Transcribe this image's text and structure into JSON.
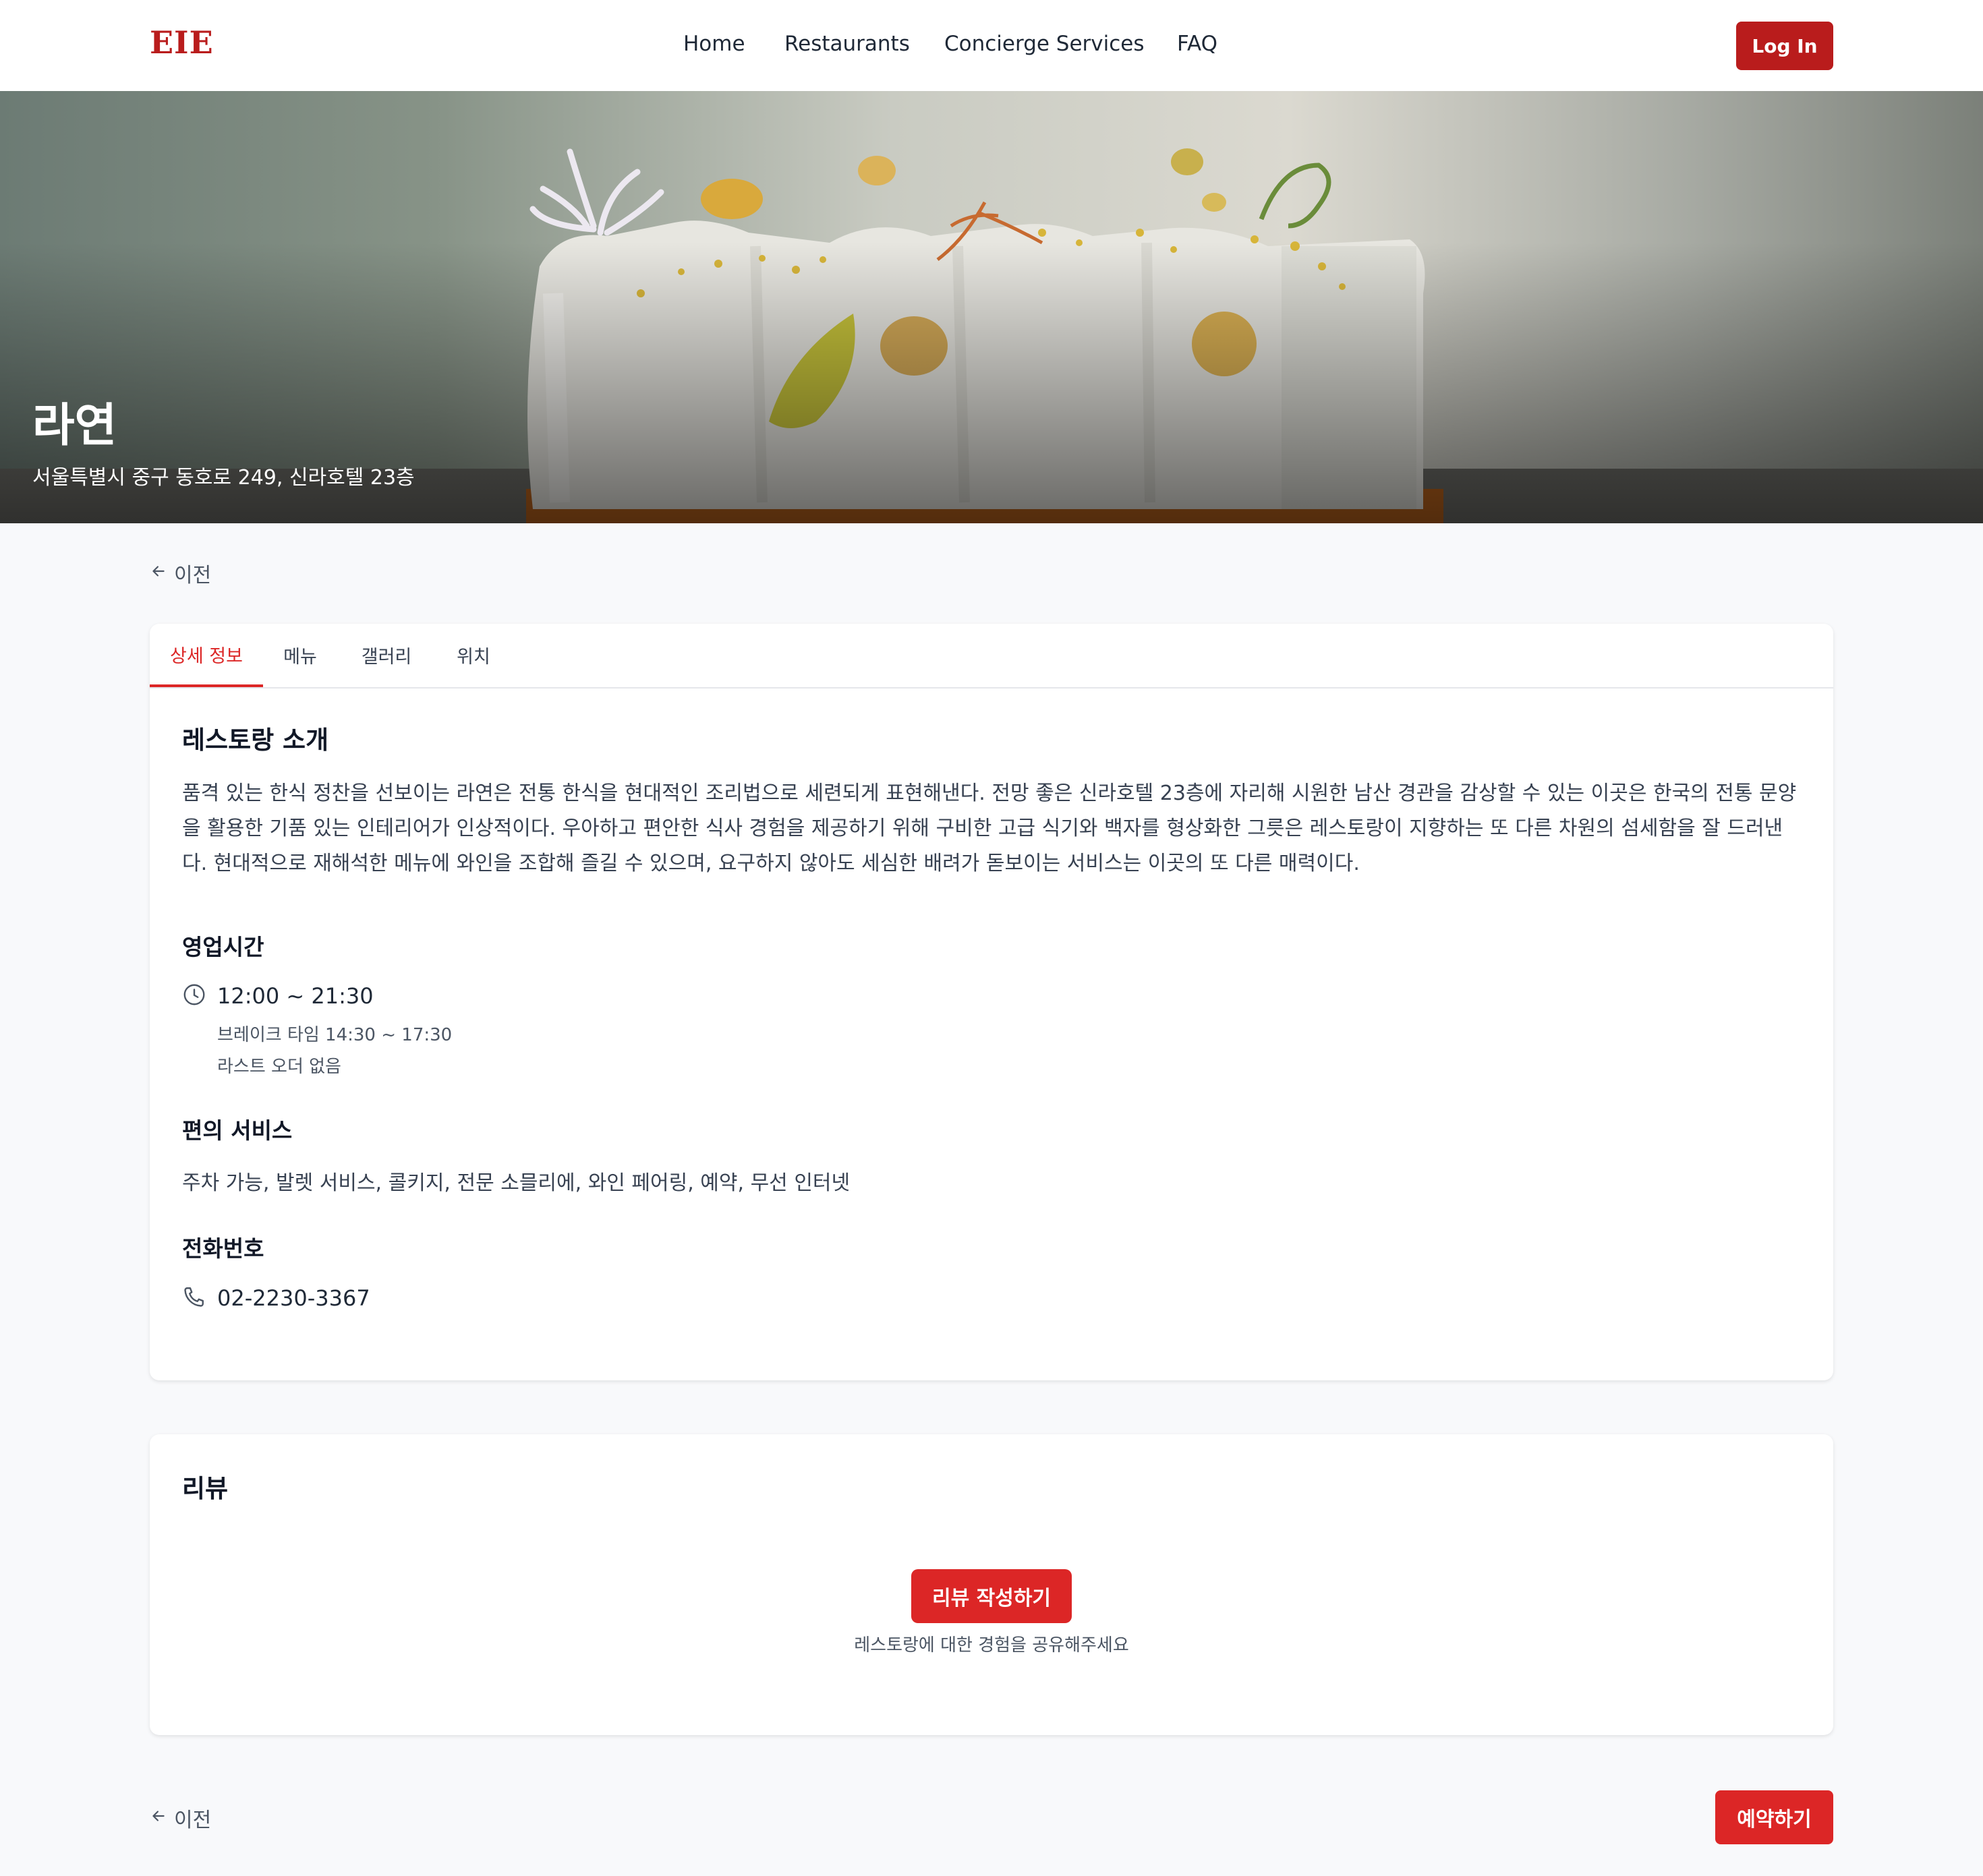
{
  "header": {
    "logo": "EIE",
    "nav": [
      {
        "label": "Home"
      },
      {
        "label": "Restaurants"
      },
      {
        "label": "Concierge Services"
      },
      {
        "label": "FAQ"
      }
    ],
    "login_label": "Log In"
  },
  "hero": {
    "title": "라연",
    "address": "서울특별시 중구 동호로 249, 신라호텔 23층"
  },
  "back_label": "이전",
  "tabs": [
    {
      "label": "상세 정보",
      "active": true
    },
    {
      "label": "메뉴",
      "active": false
    },
    {
      "label": "갤러리",
      "active": false
    },
    {
      "label": "위치",
      "active": false
    }
  ],
  "details": {
    "intro_title": "레스토랑 소개",
    "intro_text": "품격 있는 한식 정찬을 선보이는 라연은 전통 한식을 현대적인 조리법으로 세련되게 표현해낸다. 전망 좋은 신라호텔 23층에 자리해 시원한 남산 경관을 감상할 수 있는 이곳은 한국의 전통 문양을 활용한 기품 있는 인테리어가 인상적이다. 우아하고 편안한 식사 경험을 제공하기 위해 구비한 고급 식기와 백자를 형상화한 그릇은 레스토랑이 지향하는 또 다른 차원의 섬세함을 잘 드러낸다. 현대적으로 재해석한 메뉴에 와인을 조합해 즐길 수 있으며, 요구하지 않아도 세심한 배려가 돋보이는 서비스는 이곳의 또 다른 매력이다.",
    "hours_title": "영업시간",
    "hours": "12:00 ~ 21:30",
    "break_time": "브레이크 타임 14:30 ~ 17:30",
    "last_order": "라스트 오더 없음",
    "amenities_title": "편의 서비스",
    "amenities": "주차 가능, 발렛 서비스, 콜키지, 전문 소믈리에, 와인 페어링, 예약, 무선 인터넷",
    "phone_title": "전화번호",
    "phone": "02-2230-3367"
  },
  "reviews": {
    "title": "리뷰",
    "write_label": "리뷰 작성하기",
    "hint": "레스토랑에 대한 경험을 공유해주세요"
  },
  "footer": {
    "back_label": "이전",
    "reserve_label": "예약하기"
  },
  "icons": {
    "back": "arrow-left-icon",
    "hours": "clock-icon",
    "phone": "phone-icon"
  },
  "colors": {
    "brand": "#b91c1c",
    "accent": "#dc2626",
    "background": "#f8f9fb"
  }
}
